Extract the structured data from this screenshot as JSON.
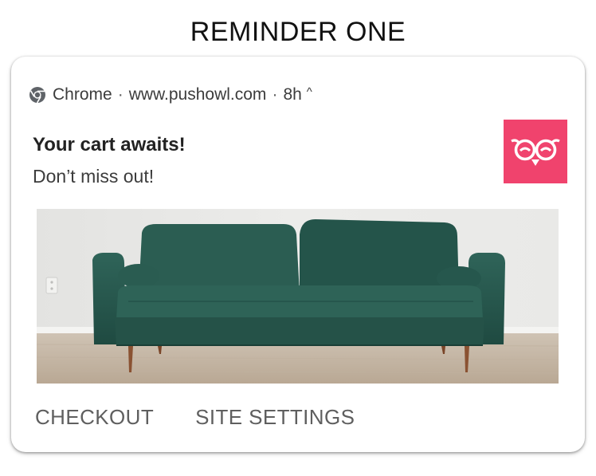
{
  "page": {
    "title": "REMINDER ONE"
  },
  "notification": {
    "source_app": "Chrome",
    "separator": "·",
    "domain": "www.pushowl.com",
    "time": "8h",
    "expand_glyph": "^",
    "title": "Your cart awaits!",
    "body": "Don’t miss out!",
    "app_icon": "owl-logo-icon",
    "image": "green-velvet-sofa",
    "actions": [
      {
        "label": "CHECKOUT"
      },
      {
        "label": "SITE SETTINGS"
      }
    ]
  },
  "colors": {
    "brand_pink": "#f0436d",
    "sofa_green": "#2a5a50",
    "action_text": "#5f5f5f"
  }
}
